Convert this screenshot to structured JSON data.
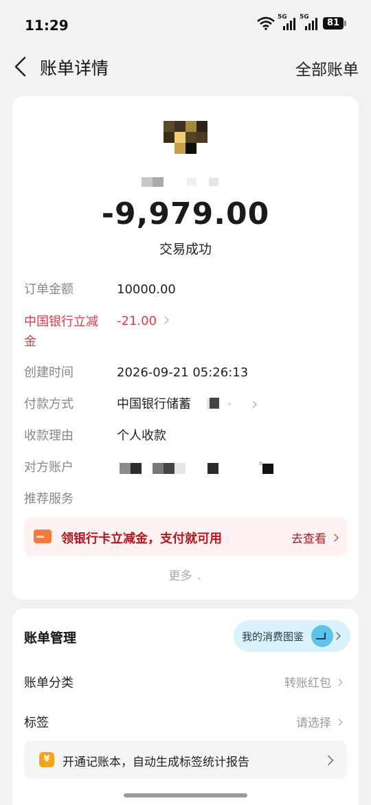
{
  "status_bar": {
    "time": "11:29",
    "signal_label_1": "5G",
    "signal_label_2": "5G",
    "battery": "81"
  },
  "nav": {
    "title": "账单详情",
    "right_action": "全部账单"
  },
  "summary": {
    "amount": "-9,979.00",
    "status": "交易成功"
  },
  "details": [
    {
      "key": "订单金额",
      "value": "10000.00"
    },
    {
      "key": "中国银行立减金",
      "value": "-21.00"
    },
    {
      "key": "创建时间",
      "value": "2026-09-21 05:26:13"
    },
    {
      "key": "付款方式",
      "value": "中国银行储蓄"
    },
    {
      "key": "收款理由",
      "value": "个人收款"
    },
    {
      "key": "对方账户",
      "value": ""
    },
    {
      "key": "推荐服务",
      "value": ""
    }
  ],
  "promo": {
    "text": "领银行卡立减金，支付就可用",
    "action": "去查看"
  },
  "more": {
    "label": "更多",
    "chevron": "⌄"
  },
  "management": {
    "title": "账单管理",
    "gallery_label": "我的消费图鉴",
    "rows": [
      {
        "key": "账单分类",
        "value": "转账红包"
      },
      {
        "key": "标签",
        "value": "请选择"
      }
    ],
    "ledger_text": "开通记账本，自动生成标签统计报告",
    "ledger_icon": "¥"
  },
  "icons": {
    "back": "chevron-left-icon",
    "wifi": "wifi-icon",
    "signal": "cellular-signal-icon",
    "battery": "battery-icon",
    "promo": "card-icon",
    "gallery": "spending-gallery-icon",
    "ledger": "yuan-ledger-icon"
  },
  "colors": {
    "accent_red": "#e0394a",
    "promo_text": "#b3171f",
    "gallery_bg": "#d9f2fb",
    "ledger_icon": "#f7a21b"
  }
}
